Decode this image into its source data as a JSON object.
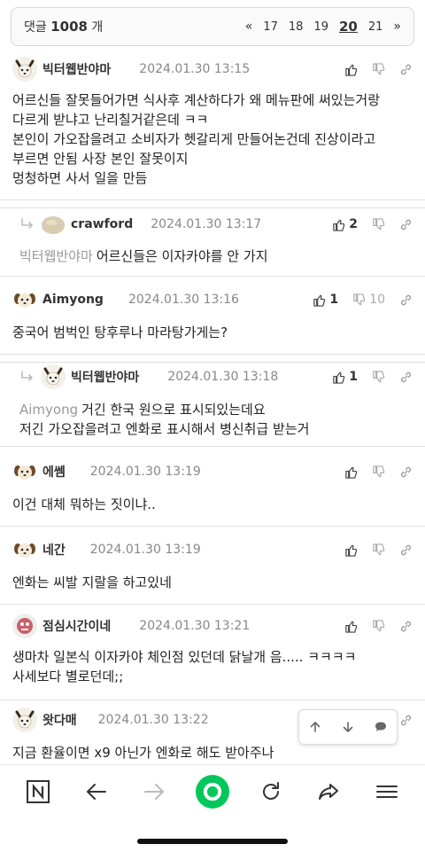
{
  "topbar": {
    "count_label": "댓글",
    "count_value": "1008",
    "count_unit": "개",
    "pager": {
      "first": "«",
      "pages": [
        "17",
        "18",
        "19",
        "20",
        "21"
      ],
      "current": "20",
      "last": "»"
    }
  },
  "comments": [
    {
      "nick": "빅터웹반야마",
      "date": "2024.01.30 13:15",
      "lines": [
        "어르신들 잘못들어가면 식사후 계산하다가 왜 메뉴판에 써있는거랑",
        "다르게 받냐고 난리칠거같은데 ㅋㅋ",
        "본인이 가오잡을려고 소비자가 헷갈리게 만들어논건데 진상이라고",
        "부르면 안됨 사장 본인 잘못이지",
        "멍청하면 사서 일을 만듬"
      ]
    },
    {
      "nick": "crawford",
      "date": "2024.01.30 13:17",
      "like_count": "2",
      "mention": "빅터웹반야마",
      "lines": [
        "어르신들은 이자카야를 안 가지"
      ]
    },
    {
      "nick": "Aimyong",
      "date": "2024.01.30 13:16",
      "like_count": "1",
      "dislike_count": "10",
      "lines": [
        "중국어 범벅인 탕후루나 마라탕가게는?"
      ]
    },
    {
      "nick": "빅터웹반야마",
      "date": "2024.01.30 13:18",
      "like_count": "1",
      "mention": "Aimyong",
      "lines": [
        "거긴 한국 원으로 표시되있는데요",
        "저긴 가오잡을려고 엔화로 표시해서 병신취급 받는거"
      ]
    },
    {
      "nick": "에쎔",
      "date": "2024.01.30 13:19",
      "lines": [
        "이건 대체 뭐하는 짓이냐.."
      ]
    },
    {
      "nick": "네간",
      "date": "2024.01.30 13:19",
      "lines": [
        "엔화는 씨발 지랄을 하고있네"
      ]
    },
    {
      "nick": "점심시간이네",
      "date": "2024.01.30 13:21",
      "lines": [
        "생마차 일본식 이자카야 체인점 있던데 닭날개 음..... ㅋㅋㅋㅋ",
        "사세보다 별로던데;;"
      ]
    },
    {
      "nick": "왓다매",
      "date": "2024.01.30 13:22",
      "lines": [
        "지금 환율이면 x9 아닌가 엔화로 해도 받아주나"
      ]
    }
  ],
  "icons": {
    "like": "thumbs-up-icon",
    "dislike": "thumbs-down-icon",
    "link": "link-icon",
    "reply": "reply-arrow-icon",
    "scroll_up": "arrow-up-icon",
    "scroll_down": "arrow-down-icon",
    "chat": "chat-bubble-icon",
    "nav": [
      "naver-n-icon",
      "back-arrow-icon",
      "forward-arrow-icon",
      "green-home-icon",
      "refresh-icon",
      "share-icon",
      "menu-icon"
    ]
  },
  "colors": {
    "accent_green": "#03c75a",
    "muted": "#888888",
    "border": "#e2e2e2"
  }
}
